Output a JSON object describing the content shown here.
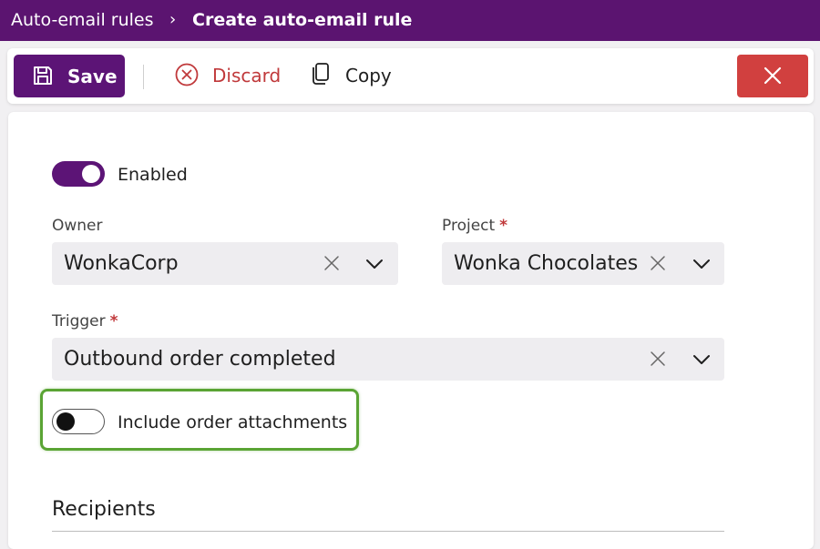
{
  "breadcrumb": {
    "root": "Auto-email rules",
    "separator": "›",
    "current": "Create auto-email rule"
  },
  "toolbar": {
    "save_label": "Save",
    "discard_label": "Discard",
    "copy_label": "Copy",
    "icons": {
      "save": "save-floppy-icon",
      "discard": "circle-x-icon",
      "copy": "copy-icon",
      "close": "close-icon"
    }
  },
  "form": {
    "enabled": {
      "label": "Enabled",
      "on": true
    },
    "owner": {
      "label": "Owner",
      "required": false,
      "value": "WonkaCorp"
    },
    "project": {
      "label": "Project",
      "required": true,
      "required_mark": "*",
      "value": "Wonka Chocolates"
    },
    "trigger": {
      "label": "Trigger",
      "required": true,
      "required_mark": "*",
      "value": "Outbound order completed"
    },
    "include_attachments": {
      "label": "Include order attachments",
      "on": false
    }
  },
  "recipients": {
    "title": "Recipients"
  },
  "colors": {
    "header": "#5b1470",
    "accent": "#5c1476",
    "danger": "#d1403f",
    "discard_text": "#c0393b",
    "highlight": "#5aa434",
    "field_bg": "#eeedf0"
  }
}
